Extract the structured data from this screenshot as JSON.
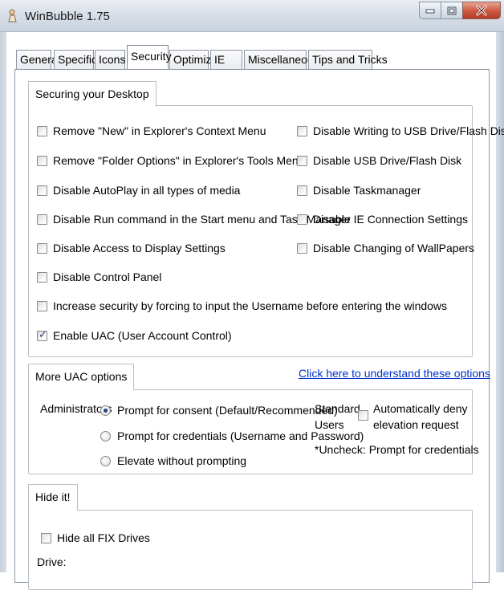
{
  "window": {
    "title": "WinBubble 1.75"
  },
  "tabs": [
    {
      "label": "General"
    },
    {
      "label": "Specific"
    },
    {
      "label": "Icons"
    },
    {
      "label": "Security"
    },
    {
      "label": "Optimize"
    },
    {
      "label": "IE"
    },
    {
      "label": "Miscellaneous"
    },
    {
      "label": "Tips and Tricks"
    }
  ],
  "active_tab": "Security",
  "securing_desktop": {
    "title": "Securing your Desktop",
    "left_options": [
      {
        "label": "Remove \"New\" in Explorer's Context Menu",
        "checked": false
      },
      {
        "label": "Remove \"Folder Options\" in Explorer's Tools Menu",
        "checked": false
      },
      {
        "label": "Disable AutoPlay in all types of media",
        "checked": false
      },
      {
        "label": "Disable Run command in the Start menu and Task Manager",
        "checked": false
      },
      {
        "label": "Disable Access to Display Settings",
        "checked": false
      },
      {
        "label": "Disable Control Panel",
        "checked": false
      },
      {
        "label": "Increase security by forcing to input the Username before entering the windows",
        "checked": false
      },
      {
        "label": "Enable UAC (User Account Control)",
        "checked": true
      }
    ],
    "right_options": [
      {
        "label": "Disable Writing to USB Drive/Flash Disk",
        "checked": false
      },
      {
        "label": "Disable USB Drive/Flash Disk",
        "checked": false
      },
      {
        "label": "Disable Taskmanager",
        "checked": false
      },
      {
        "label": "Disable IE Connection Settings",
        "checked": false
      },
      {
        "label": "Disable Changing of WallPapers",
        "checked": false
      }
    ]
  },
  "uac": {
    "title": "More UAC options",
    "help_link": "Click here to understand these options",
    "administrators_label": "Administrators",
    "admin_options": [
      {
        "label": "Prompt for consent (Default/Recommended)",
        "selected": true
      },
      {
        "label": "Prompt for credentials (Username and Password)",
        "selected": false
      },
      {
        "label": "Elevate without prompting",
        "selected": false
      }
    ],
    "standard_label_1": "Standard",
    "standard_label_2": "Users",
    "auto_deny_line1": "Automatically deny",
    "auto_deny_line2": "elevation request",
    "auto_deny_checked": false,
    "uncheck_note": "*Uncheck: Prompt for credentials"
  },
  "hide": {
    "title": "Hide it!",
    "hide_fix_drives": "Hide all FIX Drives",
    "hide_fix_drives_checked": false,
    "drive_label": "Drive:"
  },
  "colors": {
    "link": "#0033cc",
    "close_button": "#cf5b43",
    "check_mark": "#2a3d80"
  }
}
